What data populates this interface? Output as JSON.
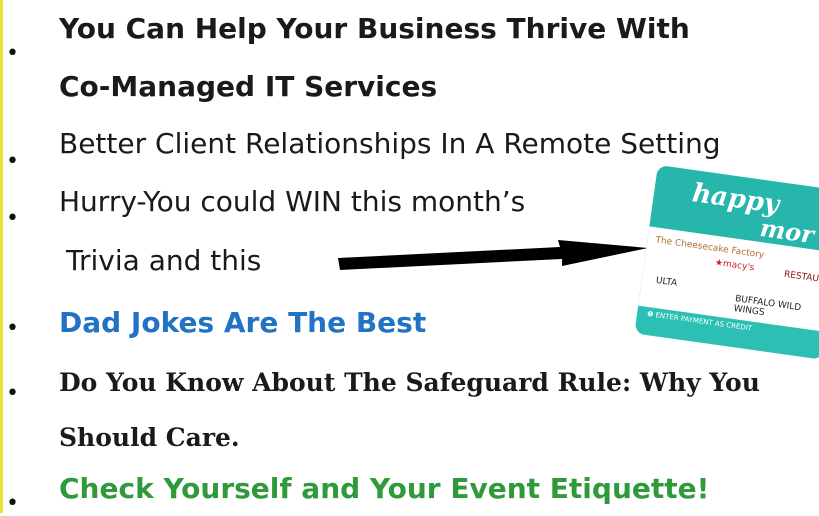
{
  "items": [
    {
      "text": "You Can Help Your Business Thrive With"
    },
    {
      "text": "Co-Managed IT Services"
    },
    {
      "text": "Better Client Relationships In A Remote Setting"
    },
    {
      "text": " Hurry-You could WIN this month’s"
    },
    {
      "text": " Trivia and this"
    },
    {
      "text": "Dad Jokes Are The Best"
    },
    {
      "text": "Do You Know About The Safeguard Rule: Why You"
    },
    {
      "text": "Should Care."
    },
    {
      "text": "Check Yourself and Your Event Etiquette!"
    }
  ],
  "bullet_glyph": "•",
  "giftcard": {
    "word1": "happy",
    "word2": "mor",
    "brands": [
      "The Cheesecake Factory",
      "★macy's",
      "RESTAURANT",
      "ULTA",
      "BUFFALO WILD WINGS"
    ],
    "footer": "❶ ENTER PAYMENT AS CREDIT"
  },
  "colors": {
    "blue": "#2273c3",
    "green": "#2f9a3a",
    "edge": "#e9e437",
    "card": "#2cc0b4"
  }
}
